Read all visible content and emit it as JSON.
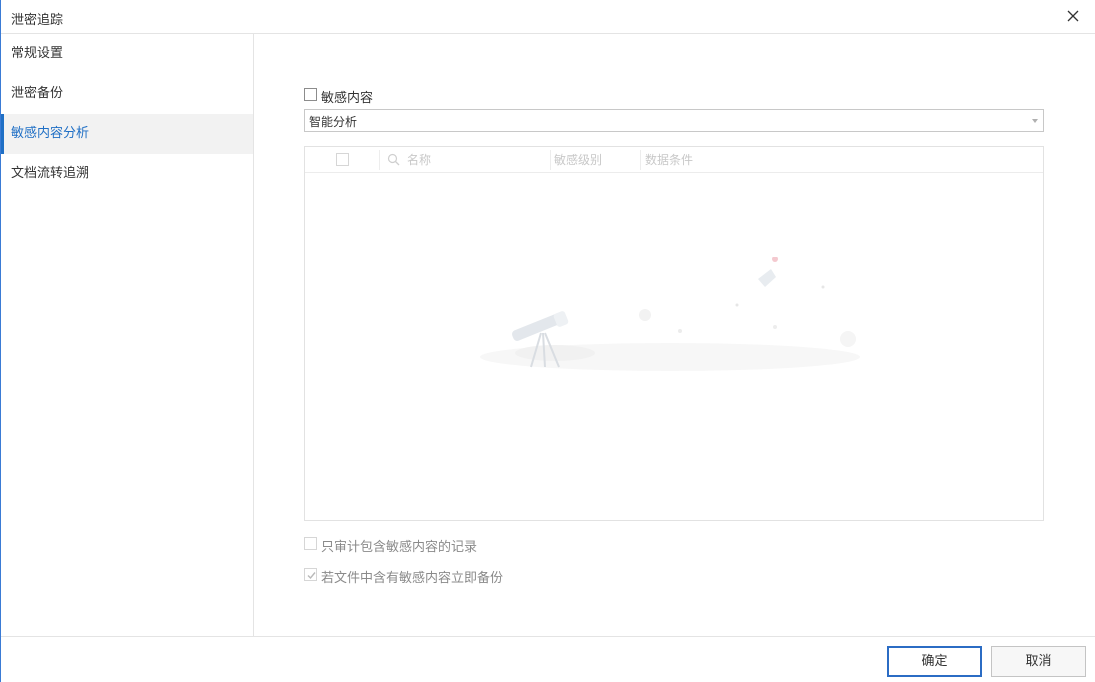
{
  "window": {
    "title": "泄密追踪"
  },
  "sidebar": {
    "items": [
      {
        "label": "常规设置"
      },
      {
        "label": "泄密备份"
      },
      {
        "label": "敏感内容分析"
      },
      {
        "label": "文档流转追溯"
      }
    ]
  },
  "main": {
    "sensitive_checkbox": {
      "label": "敏感内容",
      "checked": false
    },
    "mode_select": {
      "value": "智能分析"
    },
    "table": {
      "columns": [
        "名称",
        "敏感级别",
        "数据条件"
      ],
      "rows": []
    },
    "options": [
      {
        "label": "只审计包含敏感内容的记录",
        "checked": false,
        "disabled": true
      },
      {
        "label": "若文件中含有敏感内容立即备份",
        "checked": true,
        "disabled": true
      }
    ]
  },
  "footer": {
    "ok_label": "确定",
    "cancel_label": "取消"
  },
  "colors": {
    "accent": "#1f6fc5",
    "primary_border": "#2b6cc4"
  },
  "icons": {
    "close": "close-icon",
    "search": "search-icon",
    "dropdown": "chevron-down-icon",
    "empty": "telescope-illustration"
  }
}
